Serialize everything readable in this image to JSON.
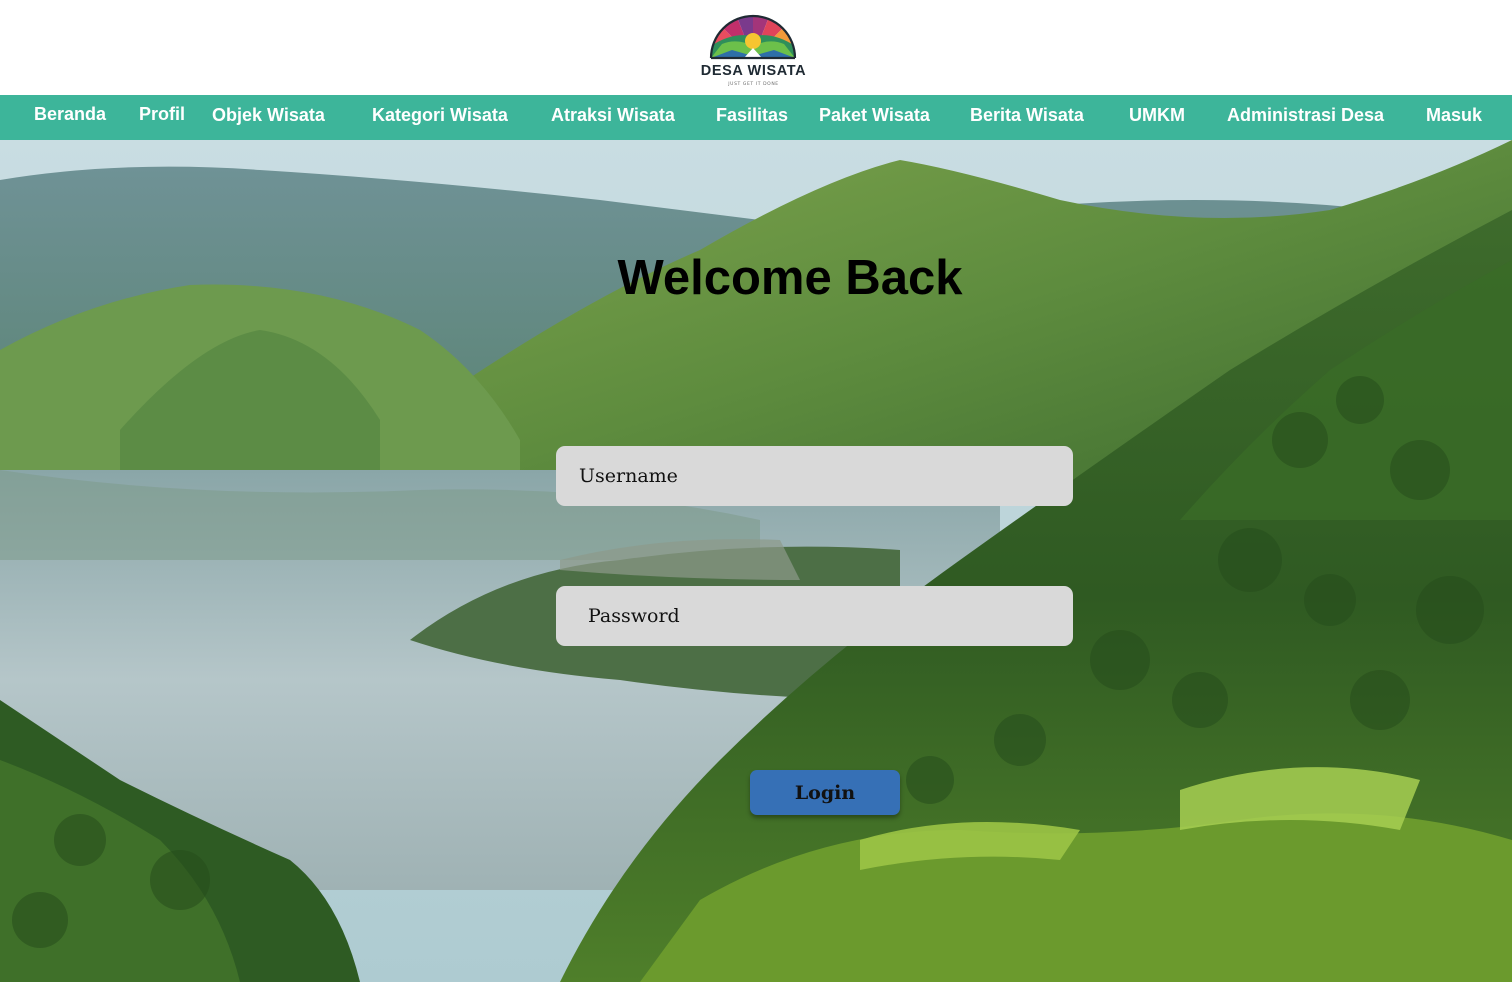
{
  "brand": {
    "name": "DESA WISATA",
    "tagline": "JUST GET IT DONE"
  },
  "nav": {
    "items": [
      {
        "label": "Beranda"
      },
      {
        "label": "Profil"
      },
      {
        "label": "Objek Wisata"
      },
      {
        "label": "Kategori Wisata"
      },
      {
        "label": "Atraksi Wisata"
      },
      {
        "label": "Fasilitas"
      },
      {
        "label": "Paket Wisata"
      },
      {
        "label": "Berita Wisata"
      },
      {
        "label": "UMKM"
      },
      {
        "label": "Administrasi Desa"
      },
      {
        "label": "Masuk"
      }
    ]
  },
  "login": {
    "heading": "Welcome Back",
    "username_placeholder": "Username",
    "password_placeholder": "Password",
    "button_label": "Login"
  },
  "colors": {
    "nav_background": "#3db59a",
    "input_background": "#d9d9d9",
    "button_background": "#3670b6"
  },
  "icons": {
    "logo": "rainbow-sun-mountain-logo",
    "hero": "lake-mountain-landscape-image"
  }
}
